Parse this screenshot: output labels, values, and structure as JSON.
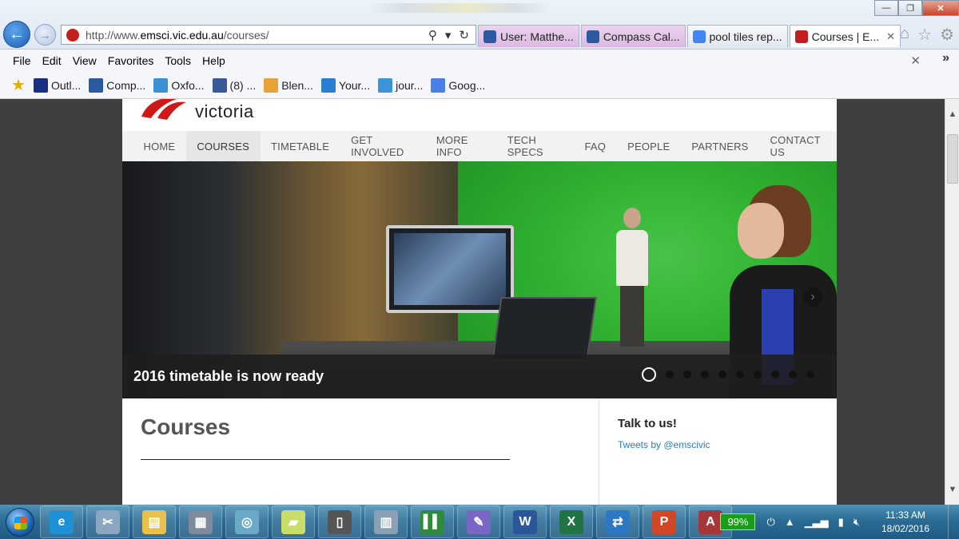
{
  "browser": {
    "url_prefix": "http://www.",
    "url_host": "emsci.vic.edu.au",
    "url_path": "/courses/",
    "tabs": [
      {
        "label": "User: Matthe...",
        "style": "pink",
        "icon_color": "#2c5aa0"
      },
      {
        "label": "Compass Cal...",
        "style": "pink",
        "icon_color": "#2c5aa0"
      },
      {
        "label": "pool tiles rep...",
        "style": "normal",
        "icon_color": "#4285f4"
      },
      {
        "label": "Courses | E...",
        "style": "active",
        "icon_color": "#c41e1e",
        "close": "✕"
      }
    ],
    "window_controls": {
      "minimize": "—",
      "restore": "❐",
      "close": "✕"
    },
    "right_tools": {
      "home": "⌂",
      "favorites": "☆",
      "settings": "⚙"
    }
  },
  "menubar": {
    "items": [
      "File",
      "Edit",
      "View",
      "Favorites",
      "Tools",
      "Help"
    ],
    "close": "✕",
    "chevron": "»"
  },
  "favorites": [
    {
      "label": "Outl...",
      "icon_color": "#1b2f80"
    },
    {
      "label": "Comp...",
      "icon_color": "#2c5aa0"
    },
    {
      "label": "Oxfo...",
      "icon_color": "#3b8fd4"
    },
    {
      "label": "(8) ...",
      "icon_color": "#3b5998"
    },
    {
      "label": "Blen...",
      "icon_color": "#e8a23a"
    },
    {
      "label": "Your...",
      "icon_color": "#2a7fd4"
    },
    {
      "label": "jour...",
      "icon_color": "#3a95d8"
    },
    {
      "label": "Goog...",
      "icon_color": "#4a7fe6"
    }
  ],
  "site": {
    "logo_text": "victoria",
    "nav": [
      "HOME",
      "COURSES",
      "TIMETABLE",
      "GET INVOLVED",
      "MORE INFO",
      "TECH SPECS",
      "FAQ",
      "PEOPLE",
      "PARTNERS",
      "CONTACT US"
    ],
    "active_nav_index": 1,
    "hero_caption": "2016 timetable is now ready",
    "slide_count": 10,
    "active_slide": 1,
    "heading": "Courses",
    "sidebar_title": "Talk to us!",
    "sidebar_link": "Tweets by @emscivic"
  },
  "taskbar": {
    "apps": [
      {
        "name": "ie",
        "glyph": "e",
        "color": "#1e90d6"
      },
      {
        "name": "snipping",
        "glyph": "✂",
        "color": "#8aa6c0"
      },
      {
        "name": "explorer",
        "glyph": "▤",
        "color": "#e8c04a"
      },
      {
        "name": "calculator",
        "glyph": "▦",
        "color": "#7d8b9c"
      },
      {
        "name": "media",
        "glyph": "◎",
        "color": "#6aa9c8"
      },
      {
        "name": "sticky",
        "glyph": "▰",
        "color": "#c8dd6a"
      },
      {
        "name": "phone",
        "glyph": "▯",
        "color": "#555"
      },
      {
        "name": "network",
        "glyph": "▥",
        "color": "#8aa0b5"
      },
      {
        "name": "green-app",
        "glyph": "▌▌",
        "color": "#2e8b3a"
      },
      {
        "name": "paint",
        "glyph": "✎",
        "color": "#7a66c4"
      },
      {
        "name": "word",
        "glyph": "W",
        "color": "#2b579a"
      },
      {
        "name": "excel",
        "glyph": "X",
        "color": "#217346"
      },
      {
        "name": "remote",
        "glyph": "⇄",
        "color": "#2d78c4"
      },
      {
        "name": "powerpoint",
        "glyph": "P",
        "color": "#d24726"
      },
      {
        "name": "access",
        "glyph": "A",
        "color": "#a4373a"
      }
    ],
    "battery": "99%",
    "time": "11:33 AM",
    "date": "18/02/2016"
  }
}
